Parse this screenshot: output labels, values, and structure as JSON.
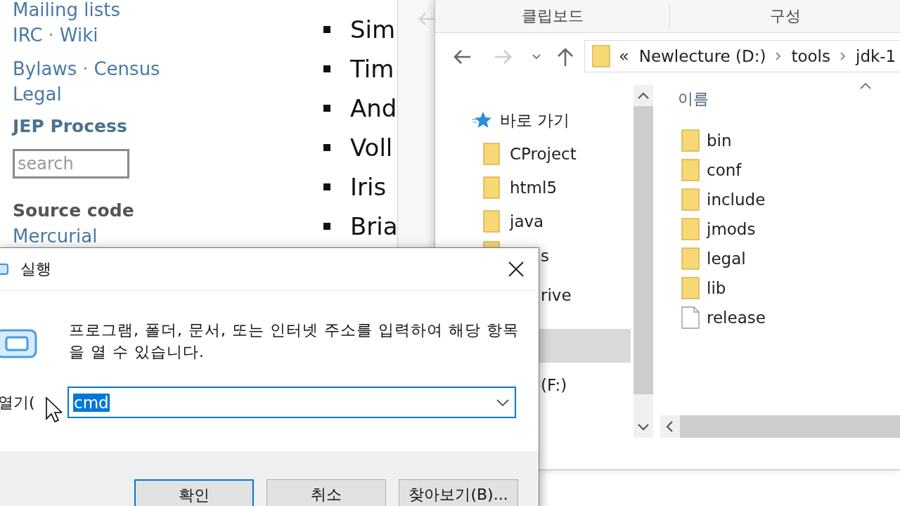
{
  "web_page": {
    "sidebar": {
      "link_groups": [
        {
          "lines": [
            {
              "links": [
                "Mailing lists"
              ]
            },
            {
              "links": [
                "IRC",
                "Wiki"
              ]
            }
          ]
        },
        {
          "lines": [
            {
              "links": [
                "Bylaws",
                "Census"
              ]
            },
            {
              "links": [
                "Legal"
              ]
            }
          ]
        }
      ],
      "separator": "·",
      "jep_heading": "JEP Process",
      "search": {
        "placeholder": "search"
      },
      "source_heading": "Source code",
      "source_link": "Mercurial"
    },
    "bullets": [
      "Sim",
      "Tim",
      "And",
      "Voll",
      "Iris",
      "Bria"
    ]
  },
  "explorer": {
    "ribbon_tabs": [
      "클립보드",
      "구성"
    ],
    "address": {
      "overflow": "«",
      "crumbs": [
        "Newlecture (D:)",
        "tools",
        "jdk-1"
      ]
    },
    "nav_pane": {
      "items": [
        {
          "kind": "quick",
          "label": "바로 가기",
          "selected": false
        },
        {
          "kind": "folder",
          "label": "CProject",
          "selected": false
        },
        {
          "kind": "folder",
          "label": "html5",
          "selected": false
        },
        {
          "kind": "folder",
          "label": "java",
          "selected": false
        },
        {
          "kind": "covered-folder",
          "label": "s",
          "selected": false
        },
        {
          "kind": "covered",
          "label": "rive",
          "selected": false
        },
        {
          "kind": "covered",
          "selected": true
        },
        {
          "kind": "covered",
          "label": "(F:)",
          "selected": false
        }
      ]
    },
    "content": {
      "column": "이름",
      "items": [
        {
          "kind": "folder",
          "name": "bin"
        },
        {
          "kind": "folder",
          "name": "conf"
        },
        {
          "kind": "folder",
          "name": "include"
        },
        {
          "kind": "folder",
          "name": "jmods"
        },
        {
          "kind": "folder",
          "name": "legal"
        },
        {
          "kind": "folder",
          "name": "lib"
        },
        {
          "kind": "file",
          "name": "release"
        }
      ]
    }
  },
  "run_dialog": {
    "title": "실행",
    "description": "프로그램, 폴더, 문서, 또는 인터넷 주소를 입력하여 해당 항목을 열 수 있습니다.",
    "open_label": "열기(",
    "value": "cmd",
    "buttons": [
      {
        "label": "확인",
        "default": true
      },
      {
        "label": "취소",
        "default": false
      },
      {
        "label": "찾아보기(B)...",
        "default": false
      }
    ]
  }
}
